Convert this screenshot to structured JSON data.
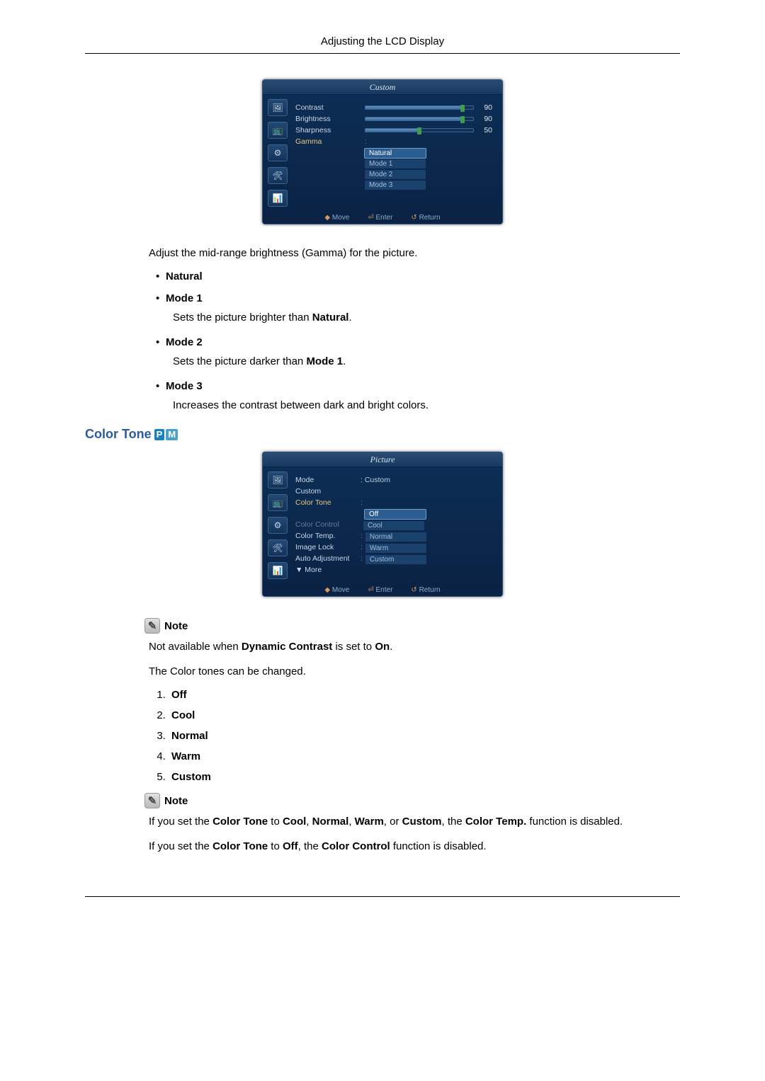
{
  "header": {
    "title": "Adjusting the LCD Display"
  },
  "osd1": {
    "title": "Custom",
    "rows": {
      "contrast": {
        "label": "Contrast",
        "value": "90",
        "pct": 90
      },
      "brightness": {
        "label": "Brightness",
        "value": "90",
        "pct": 90
      },
      "sharpness": {
        "label": "Sharpness",
        "value": "50",
        "pct": 50
      },
      "gamma": {
        "label": "Gamma"
      }
    },
    "gamma_options": [
      "Natural",
      "Mode 1",
      "Mode 2",
      "Mode 3"
    ],
    "footer": {
      "move": "Move",
      "enter": "Enter",
      "ret": "Return"
    }
  },
  "gamma_intro": "Adjust the mid-range brightness (Gamma) for the picture.",
  "gamma_list": {
    "natural": "Natural",
    "mode1": {
      "title": "Mode 1",
      "desc_a": "Sets the picture brighter than ",
      "desc_b": "Natural",
      "desc_c": "."
    },
    "mode2": {
      "title": "Mode 2",
      "desc_a": "Sets the picture darker than ",
      "desc_b": "Mode 1",
      "desc_c": "."
    },
    "mode3": {
      "title": "Mode 3",
      "desc": "Increases the contrast between dark and bright colors."
    }
  },
  "section2": {
    "title": "Color Tone",
    "badge_p": "P",
    "badge_m": "M"
  },
  "osd2": {
    "title": "Picture",
    "rows": {
      "mode": {
        "label": "Mode",
        "value": ": Custom"
      },
      "custom": {
        "label": "Custom"
      },
      "colortone": {
        "label": "Color Tone"
      },
      "colorcontrol": {
        "label": "Color Control"
      },
      "colortemp": {
        "label": "Color Temp."
      },
      "imagelock": {
        "label": "Image Lock"
      },
      "autoadjust": {
        "label": "Auto Adjustment"
      },
      "more": {
        "label": "▼ More"
      }
    },
    "tone_options": [
      "Off",
      "Cool",
      "Normal",
      "Warm",
      "Custom"
    ],
    "footer": {
      "move": "Move",
      "enter": "Enter",
      "ret": "Return"
    }
  },
  "note_label": "Note",
  "note1_a": "Not available when ",
  "note1_b": "Dynamic Contrast",
  "note1_c": " is set to ",
  "note1_d": "On",
  "note1_e": ".",
  "tone_para": "The Color tones can be changed.",
  "tone_list": {
    "off": "Off",
    "cool": "Cool",
    "normal": "Normal",
    "warm": "Warm",
    "custom": "Custom"
  },
  "note2_a": "If you set the ",
  "note2_b": "Color Tone",
  "note2_c": " to ",
  "note2_d": "Cool",
  "note2_e": ", ",
  "note2_f": "Normal",
  "note2_g": ", ",
  "note2_h": "Warm",
  "note2_i": ", or ",
  "note2_j": "Custom",
  "note2_k": ", the ",
  "note2_l": "Color Temp.",
  "note2_m": " function is disabled.",
  "note3_a": "If you set the ",
  "note3_b": "Color Tone",
  "note3_c": " to ",
  "note3_d": "Off",
  "note3_e": ", the ",
  "note3_f": "Color Control",
  "note3_g": " function is disabled."
}
